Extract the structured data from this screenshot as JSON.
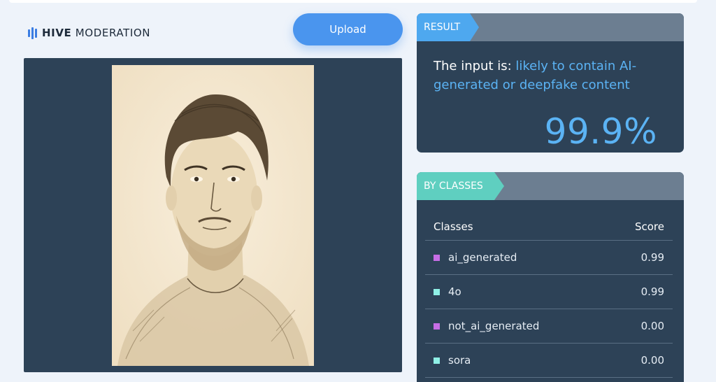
{
  "brand": {
    "name_bold": "HIVE",
    "name_rest": "MODERATION",
    "color": "#3b7de2"
  },
  "toolbar": {
    "upload_label": "Upload"
  },
  "result": {
    "tag": "RESULT",
    "prefix": "The input is: ",
    "verdict": "likely to contain AI-generated or deepfake content",
    "percent": "99.9%"
  },
  "classes": {
    "tag": "BY CLASSES",
    "col_class": "Classes",
    "col_score": "Score",
    "rows": [
      {
        "name": "ai_generated",
        "score": "0.99",
        "color": "#c76ee6"
      },
      {
        "name": "4o",
        "score": "0.99",
        "color": "#8ff0e6"
      },
      {
        "name": "not_ai_generated",
        "score": "0.00",
        "color": "#c76ee6"
      },
      {
        "name": "sora",
        "score": "0.00",
        "color": "#8ff0e6"
      }
    ]
  },
  "colors": {
    "accent": "#4a95ee",
    "panel": "#2d4257",
    "highlight": "#5bb3f4",
    "classes_tag": "#5fcfc0"
  }
}
